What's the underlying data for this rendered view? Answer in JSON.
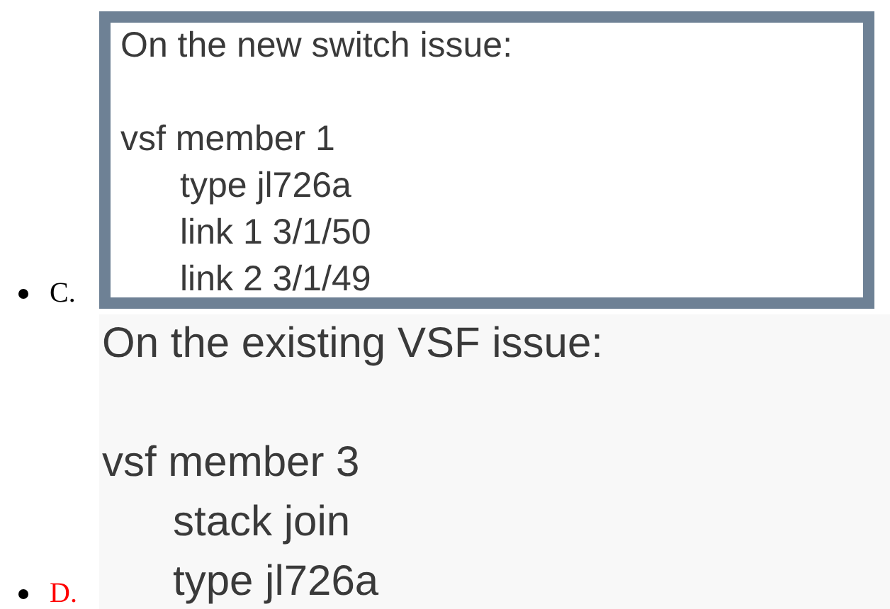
{
  "options": [
    {
      "letter": "C.",
      "correct": false,
      "kind": "framed",
      "heading": "On the new switch issue:",
      "blocks": [
        {
          "text": "vsf member 1",
          "children": [
            "type jl726a",
            "link 1 3/1/50",
            "link 2 3/1/49"
          ]
        }
      ]
    },
    {
      "letter": "D.",
      "correct": true,
      "kind": "plain",
      "heading": "On the existing VSF issue:",
      "blocks": [
        {
          "text": "vsf member 3",
          "children": [
            "stack join",
            "type jl726a"
          ]
        }
      ]
    }
  ]
}
